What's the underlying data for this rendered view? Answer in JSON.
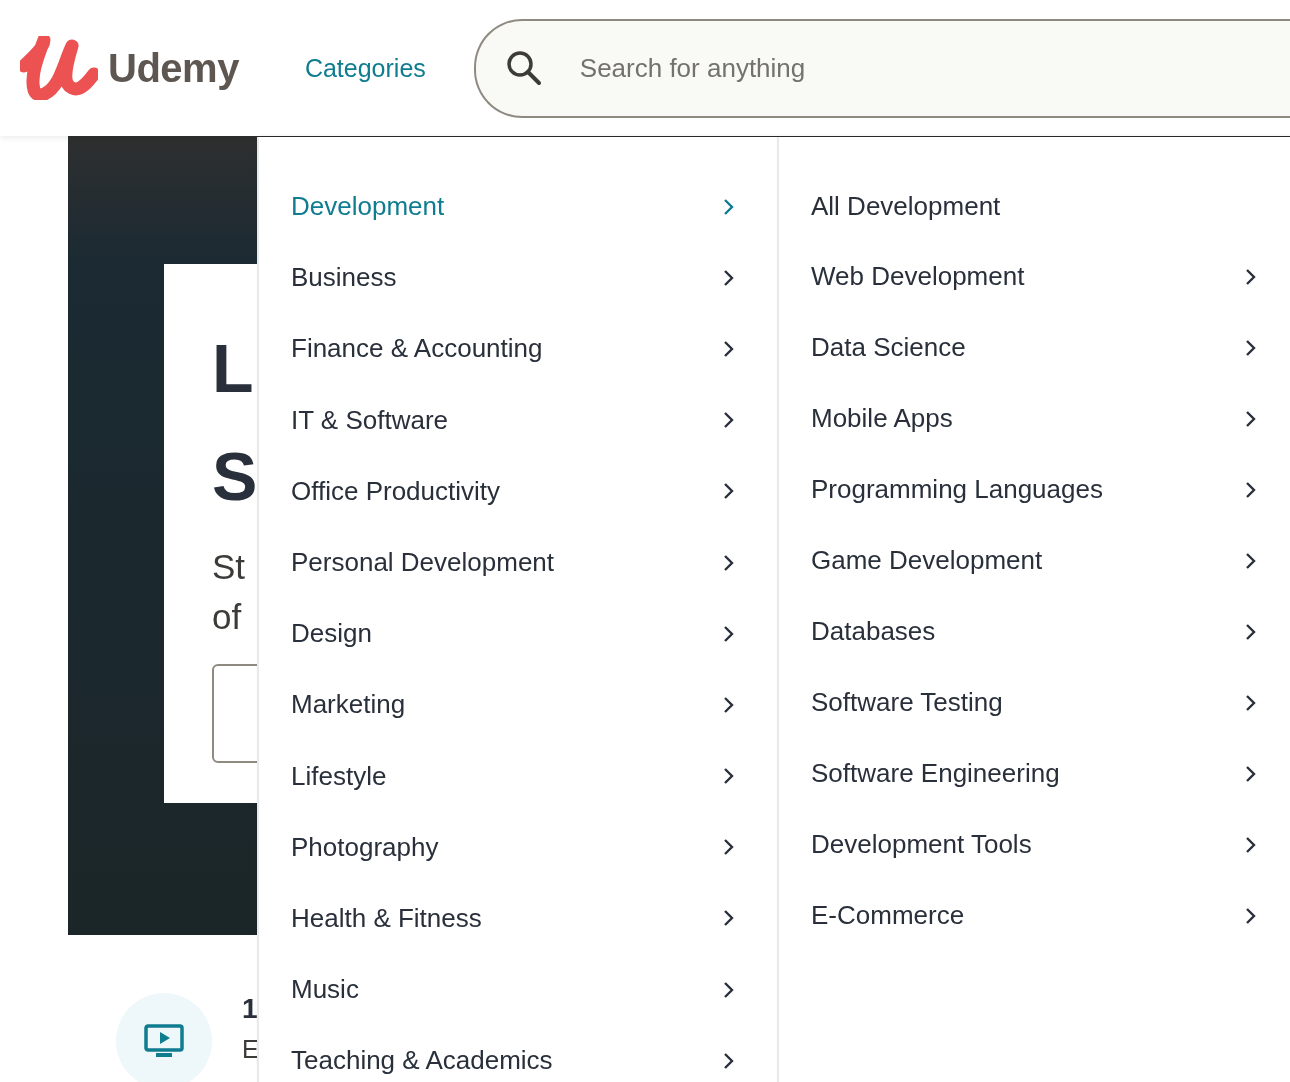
{
  "header": {
    "logo_text": "Udemy",
    "nav_link": "Categories",
    "search": {
      "placeholder": "Search for anything"
    }
  },
  "hero": {
    "heading_lines": [
      "L",
      "S"
    ],
    "subtitle_lines": [
      "St",
      "of"
    ]
  },
  "feature": {
    "title": "1",
    "subtitle": "E"
  },
  "menu": {
    "categories": [
      {
        "label": "Development",
        "selected": true
      },
      {
        "label": "Business",
        "selected": false
      },
      {
        "label": "Finance & Accounting",
        "selected": false
      },
      {
        "label": "IT & Software",
        "selected": false
      },
      {
        "label": "Office Productivity",
        "selected": false
      },
      {
        "label": "Personal Development",
        "selected": false
      },
      {
        "label": "Design",
        "selected": false
      },
      {
        "label": "Marketing",
        "selected": false
      },
      {
        "label": "Lifestyle",
        "selected": false
      },
      {
        "label": "Photography",
        "selected": false
      },
      {
        "label": "Health & Fitness",
        "selected": false
      },
      {
        "label": "Music",
        "selected": false
      },
      {
        "label": "Teaching & Academics",
        "selected": false
      }
    ],
    "subcategories": [
      {
        "label": "All Development",
        "has_children": false
      },
      {
        "label": "Web Development",
        "has_children": true
      },
      {
        "label": "Data Science",
        "has_children": true
      },
      {
        "label": "Mobile Apps",
        "has_children": true
      },
      {
        "label": "Programming Languages",
        "has_children": true
      },
      {
        "label": "Game Development",
        "has_children": true
      },
      {
        "label": "Databases",
        "has_children": true
      },
      {
        "label": "Software Testing",
        "has_children": true
      },
      {
        "label": "Software Engineering",
        "has_children": true
      },
      {
        "label": "Development Tools",
        "has_children": true
      },
      {
        "label": "E-Commerce",
        "has_children": true
      }
    ]
  }
}
